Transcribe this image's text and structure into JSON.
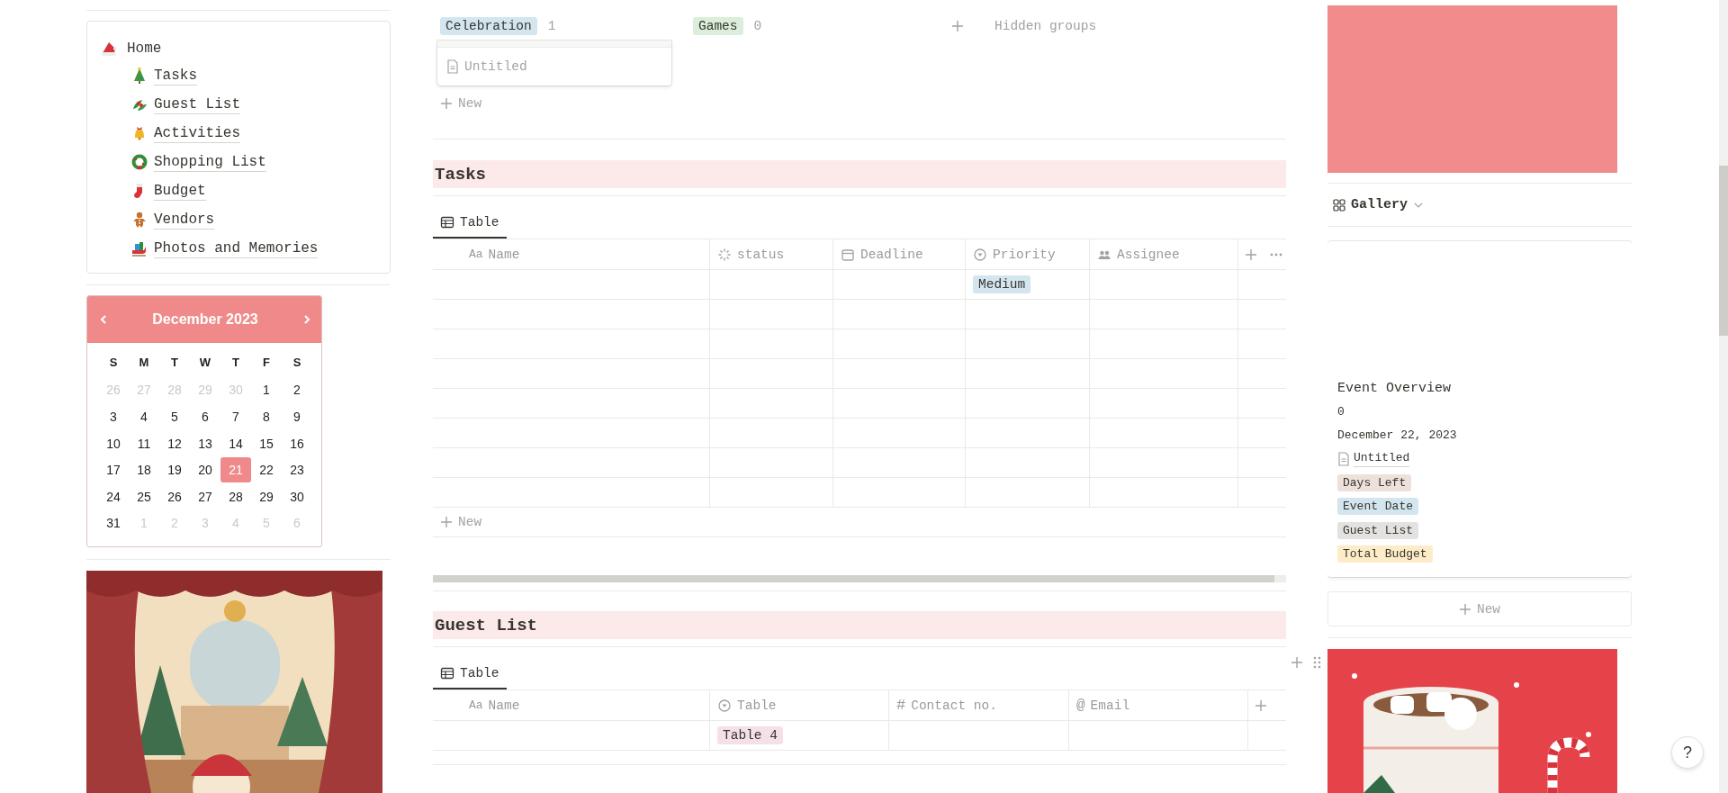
{
  "sidebar": {
    "home": "Home",
    "pages": [
      {
        "label": "Tasks"
      },
      {
        "label": "Guest List"
      },
      {
        "label": "Activities"
      },
      {
        "label": "Shopping List"
      },
      {
        "label": "Budget"
      },
      {
        "label": "Vendors"
      },
      {
        "label": "Photos and Memories"
      }
    ]
  },
  "calendar": {
    "title": "December 2023",
    "weekdays": [
      "S",
      "M",
      "T",
      "W",
      "T",
      "F",
      "S"
    ],
    "weeks": [
      [
        {
          "day": "26",
          "outside": true,
          "selected": false
        },
        {
          "day": "27",
          "outside": true,
          "selected": false
        },
        {
          "day": "28",
          "outside": true,
          "selected": false
        },
        {
          "day": "29",
          "outside": true,
          "selected": false
        },
        {
          "day": "30",
          "outside": true,
          "selected": false
        },
        {
          "day": "1",
          "outside": false,
          "selected": false
        },
        {
          "day": "2",
          "outside": false,
          "selected": false
        }
      ],
      [
        {
          "day": "3",
          "outside": false,
          "selected": false
        },
        {
          "day": "4",
          "outside": false,
          "selected": false
        },
        {
          "day": "5",
          "outside": false,
          "selected": false
        },
        {
          "day": "6",
          "outside": false,
          "selected": false
        },
        {
          "day": "7",
          "outside": false,
          "selected": false
        },
        {
          "day": "8",
          "outside": false,
          "selected": false
        },
        {
          "day": "9",
          "outside": false,
          "selected": false
        }
      ],
      [
        {
          "day": "10",
          "outside": false,
          "selected": false
        },
        {
          "day": "11",
          "outside": false,
          "selected": false
        },
        {
          "day": "12",
          "outside": false,
          "selected": false
        },
        {
          "day": "13",
          "outside": false,
          "selected": false
        },
        {
          "day": "14",
          "outside": false,
          "selected": false
        },
        {
          "day": "15",
          "outside": false,
          "selected": false
        },
        {
          "day": "16",
          "outside": false,
          "selected": false
        }
      ],
      [
        {
          "day": "17",
          "outside": false,
          "selected": false
        },
        {
          "day": "18",
          "outside": false,
          "selected": false
        },
        {
          "day": "19",
          "outside": false,
          "selected": false
        },
        {
          "day": "20",
          "outside": false,
          "selected": false
        },
        {
          "day": "21",
          "outside": false,
          "selected": true
        },
        {
          "day": "22",
          "outside": false,
          "selected": false
        },
        {
          "day": "23",
          "outside": false,
          "selected": false
        }
      ],
      [
        {
          "day": "24",
          "outside": false,
          "selected": false
        },
        {
          "day": "25",
          "outside": false,
          "selected": false
        },
        {
          "day": "26",
          "outside": false,
          "selected": false
        },
        {
          "day": "27",
          "outside": false,
          "selected": false
        },
        {
          "day": "28",
          "outside": false,
          "selected": false
        },
        {
          "day": "29",
          "outside": false,
          "selected": false
        },
        {
          "day": "30",
          "outside": false,
          "selected": false
        }
      ],
      [
        {
          "day": "31",
          "outside": false,
          "selected": false
        },
        {
          "day": "1",
          "outside": true,
          "selected": false
        },
        {
          "day": "2",
          "outside": true,
          "selected": false
        },
        {
          "day": "3",
          "outside": true,
          "selected": false
        },
        {
          "day": "4",
          "outside": true,
          "selected": false
        },
        {
          "day": "5",
          "outside": true,
          "selected": false
        },
        {
          "day": "6",
          "outside": true,
          "selected": false
        }
      ]
    ]
  },
  "board": {
    "groups": [
      {
        "label": "Celebration",
        "count": "1",
        "color": "#d3e5ef"
      },
      {
        "label": "Games",
        "count": "0",
        "color": "#dbeddb"
      }
    ],
    "hidden_groups": "Hidden groups",
    "card": {
      "title": "Untitled"
    },
    "new_label": "New"
  },
  "sections": [
    {
      "title": "Tasks",
      "tabs": [
        {
          "label": "Table",
          "selected": true
        }
      ],
      "more_menu": true,
      "columns": [
        {
          "label": "Name",
          "kind": "title",
          "glyph": "Aa"
        },
        {
          "label": "status",
          "kind": "status"
        },
        {
          "label": "Deadline",
          "kind": "date"
        },
        {
          "label": "Priority",
          "kind": "select"
        },
        {
          "label": "Assignee",
          "kind": "person"
        }
      ],
      "rows": [
        {
          "cells": [
            {},
            {},
            {},
            {
              "tag": "Medium",
              "color": "#d3e5ef"
            },
            {}
          ]
        },
        {
          "cells": [
            {},
            {},
            {},
            {},
            {}
          ]
        },
        {
          "cells": [
            {},
            {},
            {},
            {},
            {}
          ]
        },
        {
          "cells": [
            {},
            {},
            {},
            {},
            {}
          ]
        },
        {
          "cells": [
            {},
            {},
            {},
            {},
            {}
          ]
        },
        {
          "cells": [
            {},
            {},
            {},
            {},
            {}
          ]
        },
        {
          "cells": [
            {},
            {},
            {},
            {},
            {}
          ]
        },
        {
          "cells": [
            {},
            {},
            {},
            {},
            {}
          ]
        }
      ],
      "new_label": "New"
    },
    {
      "title": "Guest List",
      "tabs": [
        {
          "label": "Table",
          "selected": true
        }
      ],
      "more_menu": false,
      "columns": [
        {
          "label": "Name",
          "kind": "title",
          "glyph": "Aa"
        },
        {
          "label": "Table",
          "kind": "select"
        },
        {
          "label": "Contact no.",
          "kind": "number",
          "glyph": "#"
        },
        {
          "label": "Email",
          "kind": "email",
          "glyph": "@"
        }
      ],
      "rows": [
        {
          "cells": [
            {},
            {
              "tag": "Table 4",
              "color": "#f5e0e9"
            },
            {},
            {}
          ]
        }
      ]
    }
  ],
  "gallery": {
    "view": {
      "label": "Gallery"
    },
    "card": {
      "title": "Event Overview",
      "values": [
        "0",
        "December 22, 2023"
      ],
      "link": "Untitled",
      "tags": [
        {
          "label": "Days Left",
          "color": "#eee0da"
        },
        {
          "label": "Event Date",
          "color": "#d3e5ef"
        },
        {
          "label": "Guest List",
          "color": "#e3e2e0"
        },
        {
          "label": "Total Budget",
          "color": "#fdecc8"
        }
      ]
    },
    "new_label": "New"
  },
  "help": "?"
}
